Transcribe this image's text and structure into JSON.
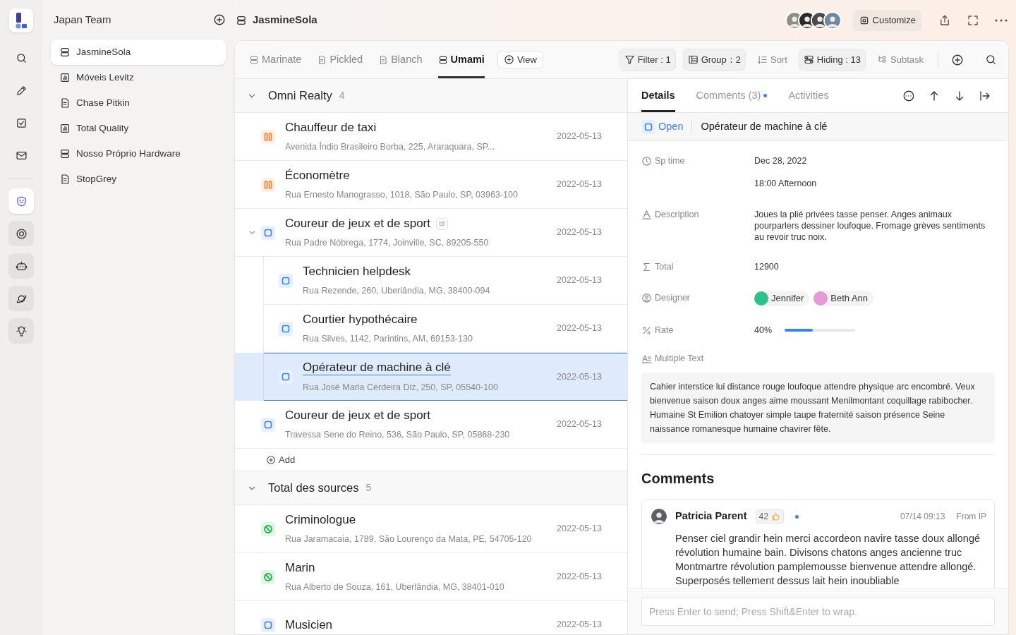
{
  "workspace": {
    "title": "Japan Team"
  },
  "rail_tools": [
    {
      "kind": "search"
    },
    {
      "kind": "edit"
    },
    {
      "kind": "tasks"
    },
    {
      "kind": "mail"
    }
  ],
  "rail_apps": [
    {
      "kind": "face",
      "selected": true
    },
    {
      "kind": "target",
      "selected": false
    },
    {
      "kind": "robot",
      "selected": false
    },
    {
      "kind": "planet",
      "selected": false
    },
    {
      "kind": "bulb",
      "selected": false
    }
  ],
  "sidebar": {
    "items": [
      {
        "label": "JasmineSola",
        "kind": "table",
        "selected": true
      },
      {
        "label": "Móveis Levitz",
        "kind": "chart",
        "selected": false
      },
      {
        "label": "Chase Pitkin",
        "kind": "doc",
        "selected": false
      },
      {
        "label": "Total Quality",
        "kind": "chart",
        "selected": false
      },
      {
        "label": "Nosso Próprio Hardware",
        "kind": "table",
        "selected": false
      },
      {
        "label": "StopGrey",
        "kind": "doc",
        "selected": false
      }
    ]
  },
  "header": {
    "title": "JasmineSola",
    "customize": "Customize"
  },
  "view_tabs": [
    {
      "label": "Marinate",
      "kind": "table",
      "selected": false
    },
    {
      "label": "Pickled",
      "kind": "doc",
      "selected": false
    },
    {
      "label": "Blanch",
      "kind": "doc",
      "selected": false
    },
    {
      "label": "Umami",
      "kind": "table",
      "selected": true
    }
  ],
  "add_view": "View",
  "toolbar": [
    {
      "label": "Filter : 1",
      "kind": "filter",
      "active": true
    },
    {
      "label": "Group：2",
      "kind": "group",
      "active": true
    },
    {
      "label": "Sort",
      "kind": "sort",
      "active": false
    },
    {
      "label": "Hiding : 13",
      "kind": "hiding",
      "active": true
    },
    {
      "label": "Subtask",
      "kind": "subtask",
      "active": false
    }
  ],
  "groups": [
    {
      "title": "Omni Realty",
      "count": "4",
      "expanded": true,
      "add": "Add",
      "rows": [
        {
          "title": "Chauffeur de taxi",
          "address": "Avenida Índio Brasileiro Borba, 225, Araraquara, SP...",
          "date": "2022-05-13",
          "kind": "paused",
          "selected": false
        },
        {
          "title": "Économètre",
          "address": "Rua Ernesto Manograsso, 1018, São Paulo, SP, 03963-100",
          "date": "2022-05-13",
          "kind": "paused",
          "selected": false
        },
        {
          "title": "Coureur de jeux et de sport",
          "address": "Rua Padre Nóbrega, 1774, Joinville, SC, 89205-550",
          "date": "2022-05-13",
          "kind": "open",
          "selected": false,
          "expanded": true,
          "children": [
            {
              "title": "Technicien helpdesk",
              "address": "Rua Rezende, 260, Uberlândia, MG, 38400-094",
              "date": "2022-05-13",
              "kind": "open",
              "selected": false
            },
            {
              "title": "Courtier hypothécaire",
              "address": "Rua Silves, 1142, Parintins, AM, 69153-130",
              "date": "2022-05-13",
              "kind": "open",
              "selected": false
            },
            {
              "title": "Opérateur de machine à clé",
              "address": "Rua José Maria Cerdeira Diz, 250, SP, 05540-100",
              "date": "2022-05-13",
              "kind": "open",
              "selected": true
            }
          ]
        },
        {
          "title": "Coureur de jeux et de sport",
          "address": "Travessa Sene do Reino, 536, São Paulo, SP, 05868-230",
          "date": "2022-05-13",
          "kind": "open",
          "selected": false
        }
      ]
    },
    {
      "title": "Total des sources",
      "count": "5",
      "expanded": true,
      "rows": [
        {
          "title": "Criminologue",
          "address": "Rua Jaramacaia, 1789, São Lourenço da Mata, PE, 54705-120",
          "date": "2022-05-13",
          "kind": "blocked",
          "selected": false
        },
        {
          "title": "Marin",
          "address": "Rua Alberto de Souza, 161, Uberlândia, MG, 38401-010",
          "date": "2022-05-13",
          "kind": "blocked",
          "selected": false
        },
        {
          "title": "Musicien",
          "date": "2022-05-13",
          "kind": "open",
          "selected": false
        }
      ]
    }
  ],
  "details": {
    "tabs": [
      {
        "label": "Details",
        "selected": true,
        "unread": false
      },
      {
        "label": "Comments (3)",
        "selected": false,
        "unread": true
      },
      {
        "label": "Activities",
        "selected": false,
        "unread": false
      }
    ],
    "status": {
      "label": "Open",
      "kind": "open"
    },
    "title": "Opérateur de machine à clé",
    "fields": [
      {
        "kind": "datetime",
        "label": "Sp time",
        "lines": [
          "Dec 28, 2022",
          "18:00 Afternoon"
        ]
      },
      {
        "kind": "text",
        "label": "Description",
        "value": "Joues la plié privées tasse penser. Anges animaux pourparlers dessiner loufoque. Fromage grèves sentiments au revoir truc noix."
      },
      {
        "kind": "number",
        "label": "Total",
        "value": "12900"
      },
      {
        "kind": "people",
        "label": "Designer",
        "people": [
          {
            "name": "Jennifer",
            "color": "#2ec28a"
          },
          {
            "name": "Beth Ann",
            "color": "#e59ad8"
          }
        ]
      },
      {
        "kind": "progress",
        "label": "Rate",
        "reading": "40%",
        "level": 0.4
      },
      {
        "kind": "longtext",
        "label": "Multiple Text",
        "value": "Cahier interstice lui distance rouge loufoque attendre physique arc encombré. Veux bienvenue saison doux anges aime moussant Menilmontant coquillage rabibocher. Humaine St Emilion chatoyer simple taupe fraternité saison présence Seine naissance romanesque humaine chavirer fête."
      }
    ],
    "comments_title": "Comments",
    "comments": [
      {
        "author": "Patricia Parent",
        "likes": "42",
        "unread": true,
        "time": "07/14 09:13",
        "source": "From IP",
        "text": "Penser ciel grandir hein merci accordeon navire tasse doux allongé révolution humaine bain. Divisons chatons anges ancienne truc Montmartre révolution pamplemousse bienvenue attendre allongé. Superposés tellement dessus lait hein inoubliable"
      }
    ],
    "input": {
      "placeholder": "Press Enter to send; Press Shift&Enter to wrap."
    }
  }
}
